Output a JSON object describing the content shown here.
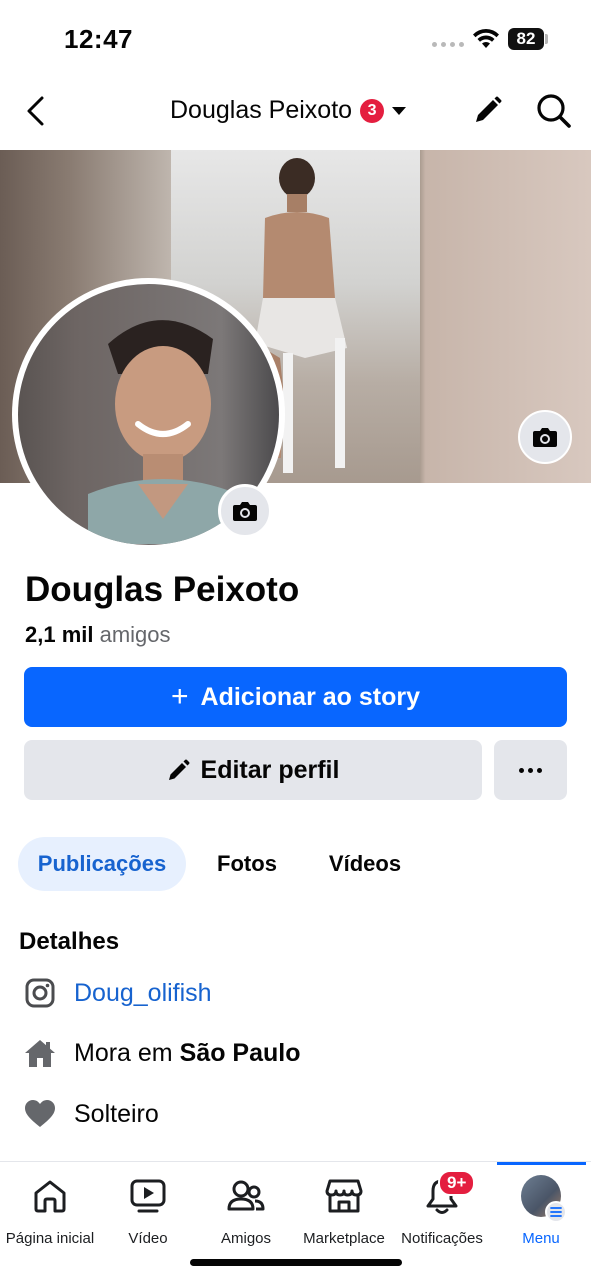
{
  "status_bar": {
    "time": "12:47",
    "battery": "82"
  },
  "header": {
    "title": "Douglas Peixoto",
    "badge": "3",
    "icons": [
      "back-arrow-icon",
      "caret-down-icon",
      "pencil-icon",
      "search-icon"
    ]
  },
  "profile": {
    "name": "Douglas Peixoto",
    "friends_count": "2,1 mil",
    "friends_label": "amigos"
  },
  "actions": {
    "add_story_label": "Adicionar ao story",
    "edit_profile_label": "Editar perfil"
  },
  "tabs": [
    {
      "label": "Publicações",
      "active": true
    },
    {
      "label": "Fotos",
      "active": false
    },
    {
      "label": "Vídeos",
      "active": false
    }
  ],
  "details": {
    "title": "Detalhes",
    "instagram": "Doug_olifish",
    "lives_in_prefix": "Mora em",
    "lives_in_city": "São Paulo",
    "relationship": "Solteiro"
  },
  "bottom_nav": {
    "items": [
      {
        "label": "Página inicial",
        "icon": "home-icon"
      },
      {
        "label": "Vídeo",
        "icon": "video-icon"
      },
      {
        "label": "Amigos",
        "icon": "friends-icon"
      },
      {
        "label": "Marketplace",
        "icon": "marketplace-icon"
      },
      {
        "label": "Notificações",
        "icon": "bell-icon",
        "badge": "9+"
      },
      {
        "label": "Menu",
        "icon": "menu-avatar",
        "active": true
      }
    ]
  },
  "colors": {
    "brand_blue": "#0866ff",
    "link_blue": "#1763cf",
    "badge_red": "#e41e3f",
    "button_gray": "#e4e6eb"
  }
}
